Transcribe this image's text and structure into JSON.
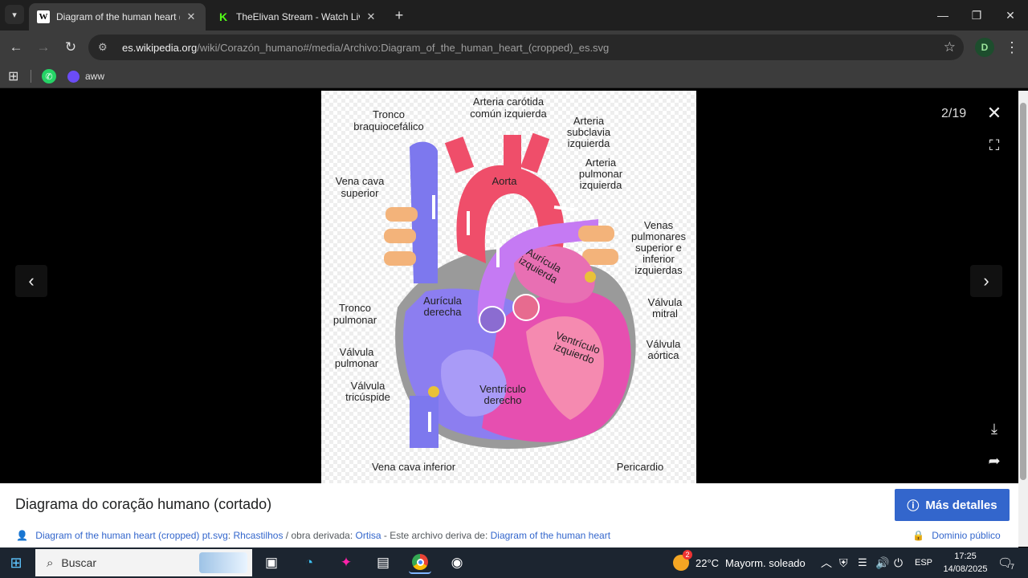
{
  "browser": {
    "tabs": [
      {
        "title": "Diagram of the human heart (c",
        "favicon": "W",
        "active": true
      },
      {
        "title": "TheElivan Stream - Watch Live o",
        "favicon": "K",
        "active": false
      }
    ],
    "url_host": "es.wikipedia.org",
    "url_path": "/wiki/Corazón_humano#/media/Archivo:Diagram_of_the_human_heart_(cropped)_es.svg",
    "profile_initial": "D",
    "bookmarks": [
      {
        "label": ""
      },
      {
        "label": ""
      },
      {
        "label": "aww"
      }
    ]
  },
  "viewer": {
    "counter": "2/19",
    "diagram_labels": {
      "tronco_braquio": [
        "Tronco",
        "braquiocefálico"
      ],
      "carotida": [
        "Arteria carótida",
        "común izquierda"
      ],
      "subclavia": [
        "Arteria",
        "subclavia",
        "izquierda"
      ],
      "vena_cava_sup": [
        "Vena cava",
        "superior"
      ],
      "aorta": "Aorta",
      "pulmonar_izq": [
        "Arteria",
        "pulmonar",
        "izquierda"
      ],
      "venas_pulm": [
        "Venas",
        "pulmonares",
        "superior e",
        "inferior",
        "izquierdas"
      ],
      "auricula_izq": [
        "Aurícula",
        "izquierda"
      ],
      "auricula_der": [
        "Aurícula",
        "derecha"
      ],
      "tronco_pulm": [
        "Tronco",
        "pulmonar"
      ],
      "valv_mitral": [
        "Válvula",
        "mitral"
      ],
      "valv_aortica": [
        "Válvula",
        "aórtica"
      ],
      "valv_pulmonar": [
        "Válvula",
        "pulmonar"
      ],
      "ventriculo_izq": [
        "Ventrículo",
        "izquierdo"
      ],
      "valv_tricuspide": [
        "Válvula",
        "tricúspide"
      ],
      "ventriculo_der": [
        "Ventrículo",
        "derecho"
      ],
      "vena_cava_inf": "Vena cava inferior",
      "pericardio": "Pericardio"
    }
  },
  "info": {
    "caption": "Diagrama do coração humano (cortado)",
    "more_button": "Más detalles",
    "credit_link1": "Diagram of the human heart (cropped) pt.svg",
    "credit_sep1": ": ",
    "credit_author1": "Rhcastilhos",
    "credit_mid": " / obra derivada: ",
    "credit_author2": "Ortisa",
    "credit_mid2": " - Este archivo deriva de: ",
    "credit_link2": "Diagram of the human heart",
    "license": "Dominio público"
  },
  "taskbar": {
    "search_placeholder": "Buscar",
    "weather_temp": "22°C",
    "weather_text": "Mayorm. soleado",
    "weather_badge": "2",
    "language": "ESP",
    "time": "17:25",
    "date": "14/08/2025",
    "notifications": "7"
  }
}
